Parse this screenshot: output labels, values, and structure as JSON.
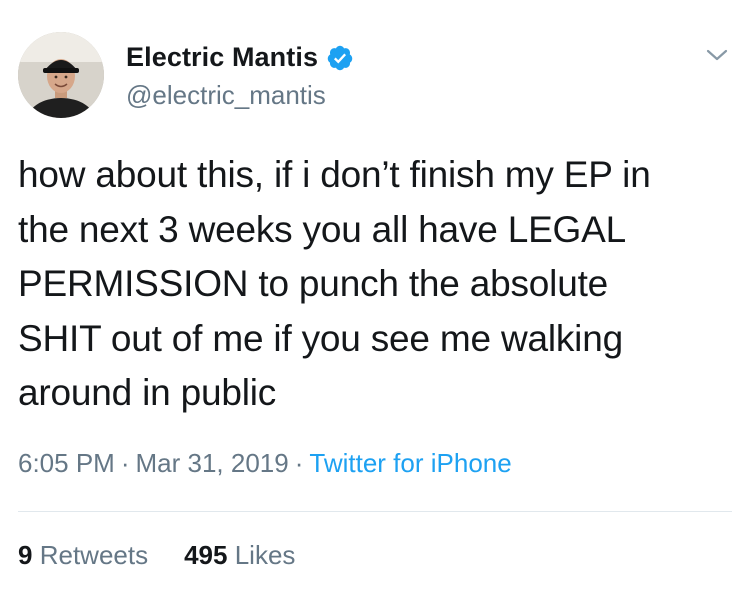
{
  "tweet": {
    "display_name": "Electric Mantis",
    "handle": "@electric_mantis",
    "text": "how about this, if i don’t finish my EP in\nthe next 3 weeks you all have LEGAL\nPERMISSION to punch the absolute\nSHIT out of me if you see me walking\naround in public",
    "time": "6:05 PM",
    "date": "Mar 31, 2019",
    "separator": "·",
    "source": "Twitter for iPhone",
    "retweets_count": "9",
    "retweets_label": "Retweets",
    "likes_count": "495",
    "likes_label": "Likes"
  },
  "icons": {
    "verified": "verified-badge-icon",
    "menu": "chevron-down-icon"
  },
  "colors": {
    "verified_blue": "#1da1f2",
    "link_blue": "#1da1f2",
    "secondary_gray": "#657786",
    "primary_text": "#14171a"
  }
}
